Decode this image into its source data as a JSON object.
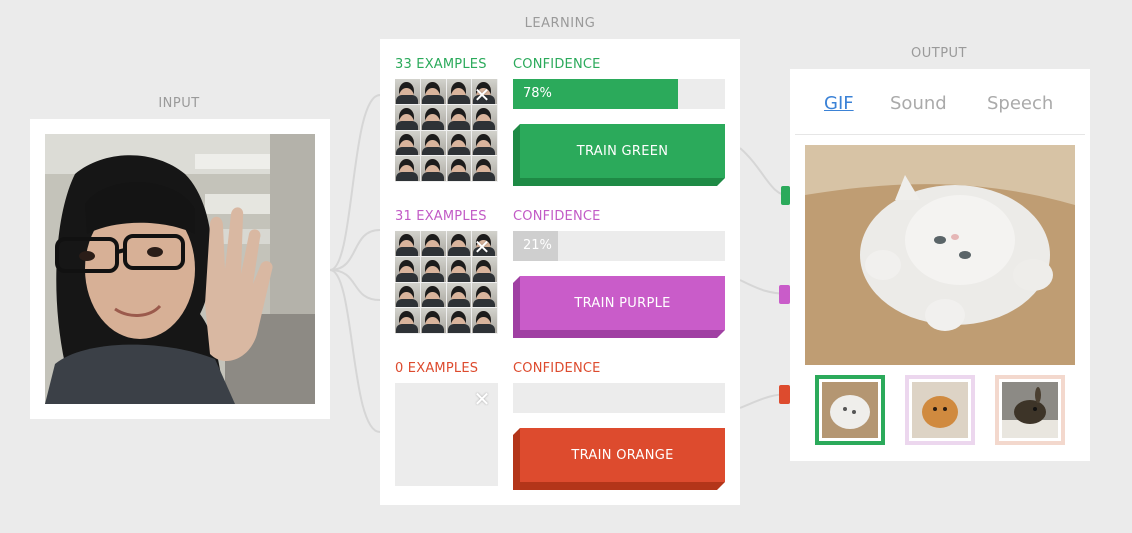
{
  "sections": {
    "input": "INPUT",
    "learning": "LEARNING",
    "output": "OUTPUT"
  },
  "classes": [
    {
      "id": "green",
      "examples_label": "33 EXAMPLES",
      "confidence_label": "CONFIDENCE",
      "confidence_value": 0.78,
      "confidence_text": "78%",
      "train_label": "TRAIN GREEN",
      "color": "#2baa5b",
      "clear_icon": "close-icon"
    },
    {
      "id": "purple",
      "examples_label": "31 EXAMPLES",
      "confidence_label": "CONFIDENCE",
      "confidence_value": 0.21,
      "confidence_text": "21%",
      "train_label": "TRAIN PURPLE",
      "color": "#c95cc9",
      "clear_icon": "close-icon"
    },
    {
      "id": "orange",
      "examples_label": "0 EXAMPLES",
      "confidence_label": "CONFIDENCE",
      "confidence_value": 0,
      "confidence_text": "",
      "train_label": "TRAIN ORANGE",
      "color": "#dd4b2e",
      "clear_icon": "close-icon"
    }
  ],
  "output": {
    "tabs": [
      "GIF",
      "Sound",
      "Speech"
    ],
    "active_tab": "GIF",
    "gif_options": [
      "cat",
      "pomeranian",
      "bunny"
    ],
    "selected_gif": "cat"
  }
}
